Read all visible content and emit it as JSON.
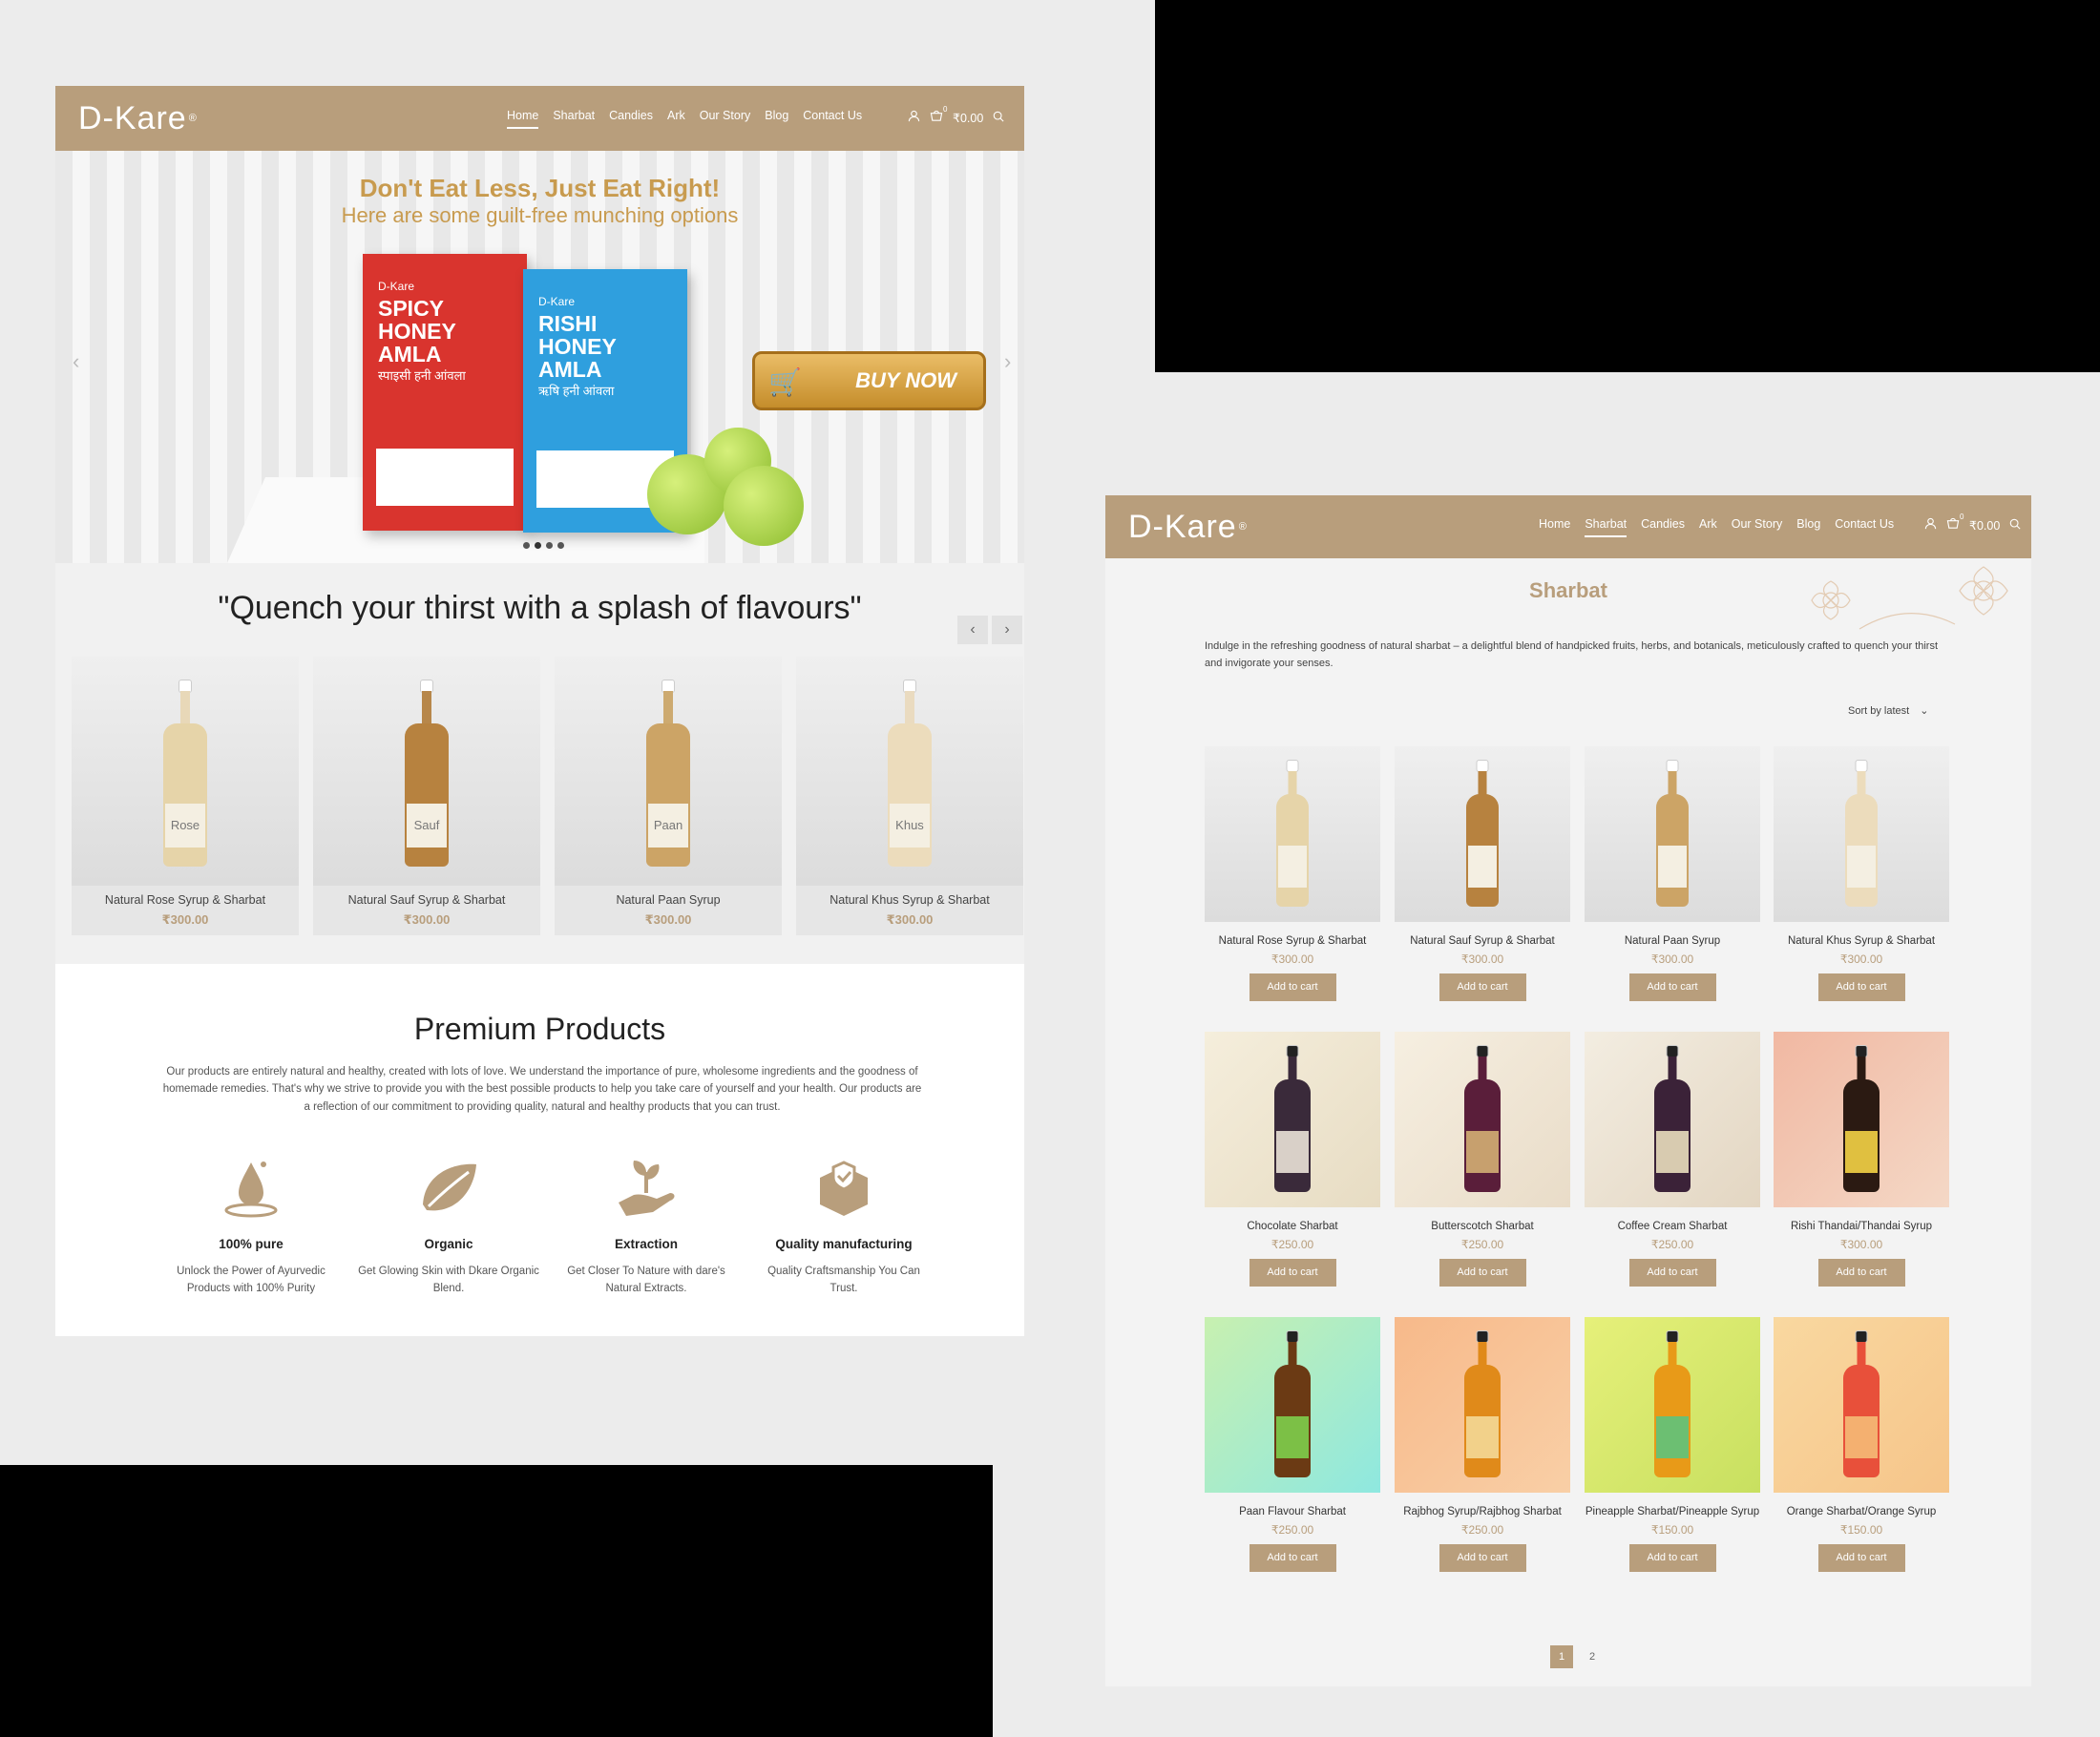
{
  "brand": {
    "logo": "D-Kare",
    "registered": "®"
  },
  "nav": [
    "Home",
    "Sharbat",
    "Candies",
    "Ark",
    "Our Story",
    "Blog",
    "Contact Us"
  ],
  "cart": {
    "count": "0",
    "total": "₹0.00"
  },
  "home": {
    "hero": {
      "title": "Don't Eat Less, Just Eat Right!",
      "subtitle": "Here are some guilt-free munching options",
      "pouch_red": {
        "brand": "D-Kare",
        "name": "SPICY HONEY AMLA",
        "hindi": "स्पाइसी हनी आंवला"
      },
      "pouch_blue": {
        "brand": "D-Kare",
        "name": "RISHI HONEY AMLA",
        "hindi": "ऋषि हनी आंवला"
      },
      "buy_now": "BUY NOW"
    },
    "quote": "\"Quench your thirst with a splash of flavours\"",
    "carousel": [
      {
        "name": "Natural Rose Syrup & Sharbat",
        "price": "₹300.00",
        "label": "Rose"
      },
      {
        "name": "Natural Sauf Syrup & Sharbat",
        "price": "₹300.00",
        "label": "Sauf"
      },
      {
        "name": "Natural Paan Syrup",
        "price": "₹300.00",
        "label": "Paan"
      },
      {
        "name": "Natural Khus Syrup & Sharbat",
        "price": "₹300.00",
        "label": "Khus"
      }
    ],
    "premium": {
      "title": "Premium Products",
      "text": "Our products are entirely natural and healthy, created with lots of love. We understand the importance of pure, wholesome ingredients and the goodness of homemade remedies. That's why we strive to provide you with the best possible products to help you take care of yourself and your health. Our products are a reflection of our commitment to providing quality, natural and healthy products that you can trust.",
      "features": [
        {
          "title": "100% pure",
          "desc": "Unlock the Power of Ayurvedic Products with 100% Purity",
          "icon": "drop-icon"
        },
        {
          "title": "Organic",
          "desc": "Get Glowing Skin with Dkare Organic Blend.",
          "icon": "leaf-icon"
        },
        {
          "title": "Extraction",
          "desc": "Get Closer To Nature with dare's Natural Extracts.",
          "icon": "plant-hand-icon"
        },
        {
          "title": "Quality manufacturing",
          "desc": "Quality Craftsmanship You Can Trust.",
          "icon": "shield-box-icon"
        }
      ]
    }
  },
  "shop": {
    "title": "Sharbat",
    "description": "Indulge in the refreshing goodness of natural sharbat – a delightful blend of handpicked fruits, herbs, and botanicals, meticulously crafted to quench your thirst and invigorate your senses.",
    "sort": "Sort by latest",
    "add_to_cart": "Add to cart",
    "products": [
      {
        "name": "Natural Rose Syrup & Sharbat",
        "price": "₹300.00"
      },
      {
        "name": "Natural Sauf Syrup & Sharbat",
        "price": "₹300.00"
      },
      {
        "name": "Natural Paan Syrup",
        "price": "₹300.00"
      },
      {
        "name": "Natural Khus Syrup & Sharbat",
        "price": "₹300.00"
      },
      {
        "name": "Chocolate Sharbat",
        "price": "₹250.00"
      },
      {
        "name": "Butterscotch Sharbat",
        "price": "₹250.00"
      },
      {
        "name": "Coffee Cream Sharbat",
        "price": "₹250.00"
      },
      {
        "name": "Rishi Thandai/Thandai Syrup",
        "price": "₹300.00"
      },
      {
        "name": "Paan Flavour Sharbat",
        "price": "₹250.00"
      },
      {
        "name": "Rajbhog Syrup/Rajbhog Sharbat",
        "price": "₹250.00"
      },
      {
        "name": "Pineapple Sharbat/Pineapple Syrup",
        "price": "₹150.00"
      },
      {
        "name": "Orange Sharbat/Orange Syrup",
        "price": "₹150.00"
      }
    ],
    "pages": [
      "1",
      "2"
    ]
  },
  "colors": {
    "brand": "#b89e7c",
    "hero_text": "#c89b4f"
  }
}
